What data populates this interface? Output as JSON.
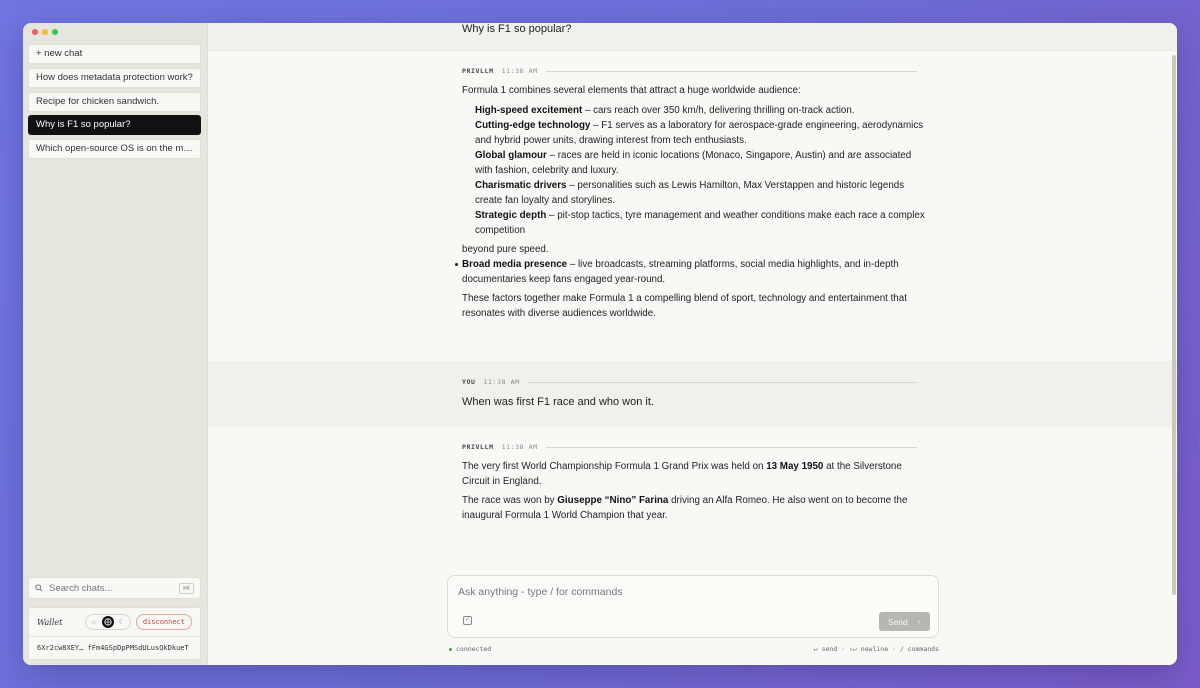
{
  "sidebar": {
    "new_chat": "+ new chat",
    "chats": [
      "How does metadata protection work?",
      "Recipe for chicken sandwich.",
      "Why is F1 so popular?",
      "Which open-source OS is on the market?"
    ],
    "active_index": 2,
    "search_placeholder": "Search chats...",
    "search_shortcut": "⌘K"
  },
  "wallet": {
    "label": "Wallet",
    "disconnect": "disconnect",
    "address": "6Xr2cw8XEY… fFm4GSpDpPMSdULusQkDkueT",
    "theme_options": [
      "light-icon",
      "system-icon",
      "dark-icon"
    ],
    "theme_active": "system-icon"
  },
  "conversation": {
    "prev_question": "Why is F1 so popular?",
    "reply1": {
      "role": "PRIVLLM",
      "time": "11:36 AM",
      "intro": "Formula 1 combines several elements that attract a huge worldwide audience:",
      "items": [
        {
          "bold": "High-speed excitement",
          "text": " – cars reach over 350 km/h, delivering thrilling on-track action."
        },
        {
          "bold": "Cutting-edge technology",
          "text": " – F1 serves as a laboratory for aerospace-grade engineering, aerodynamics and hybrid power units, drawing interest from tech enthusiasts."
        },
        {
          "bold": "Global glamour",
          "text": " – races are held in iconic locations (Monaco, Singapore, Austin) and are associated with fashion, celebrity and luxury."
        },
        {
          "bold": "Charismatic drivers",
          "text": " – personalities such as Lewis Hamilton, Max Verstappen and historic legends create fan loyalty and storylines."
        },
        {
          "bold": "Strategic depth",
          "text": " – pit-stop tactics, tyre management and weather conditions make each race a complex competition"
        }
      ],
      "continuation": "beyond pure speed.",
      "bullet": {
        "bold": "Broad media presence",
        "text": " – live broadcasts, streaming platforms, social media highlights, and in-depth documentaries keep fans engaged year-round."
      },
      "outro": "These factors together make Formula 1 a compelling blend of sport, technology and entertainment that resonates with diverse audiences worldwide."
    },
    "user_msg": {
      "role": "YOU",
      "time": "11:38 AM",
      "text": "When was first F1 race and who won it."
    },
    "reply2": {
      "role": "PRIVLLM",
      "time": "11:38 AM",
      "p1_pre": "The very first World Championship Formula 1 Grand Prix was held on ",
      "p1_bold": "13 May 1950",
      "p1_post": " at the Silverstone Circuit in England.",
      "p2_pre": "The race was won by ",
      "p2_bold": "Giuseppe “Nino” Farina",
      "p2_post": " driving an Alfa Romeo. He also went on to become the inaugural Formula 1 World Champion that year."
    }
  },
  "composer": {
    "placeholder": "Ask anything - type / for commands",
    "send_label": "Send",
    "send_icon": "arrow-up-icon",
    "attach_icon": "attach-icon"
  },
  "status": {
    "connection": "connected",
    "hints": "↵ send · ⇧↵ newline · / commands"
  },
  "colors": {
    "background_gradient_start": "#6f74e0",
    "background_gradient_end": "#7a5cc9",
    "active_chat": "#111111",
    "disconnect": "#cc4444",
    "connected": "#3fa34d"
  }
}
